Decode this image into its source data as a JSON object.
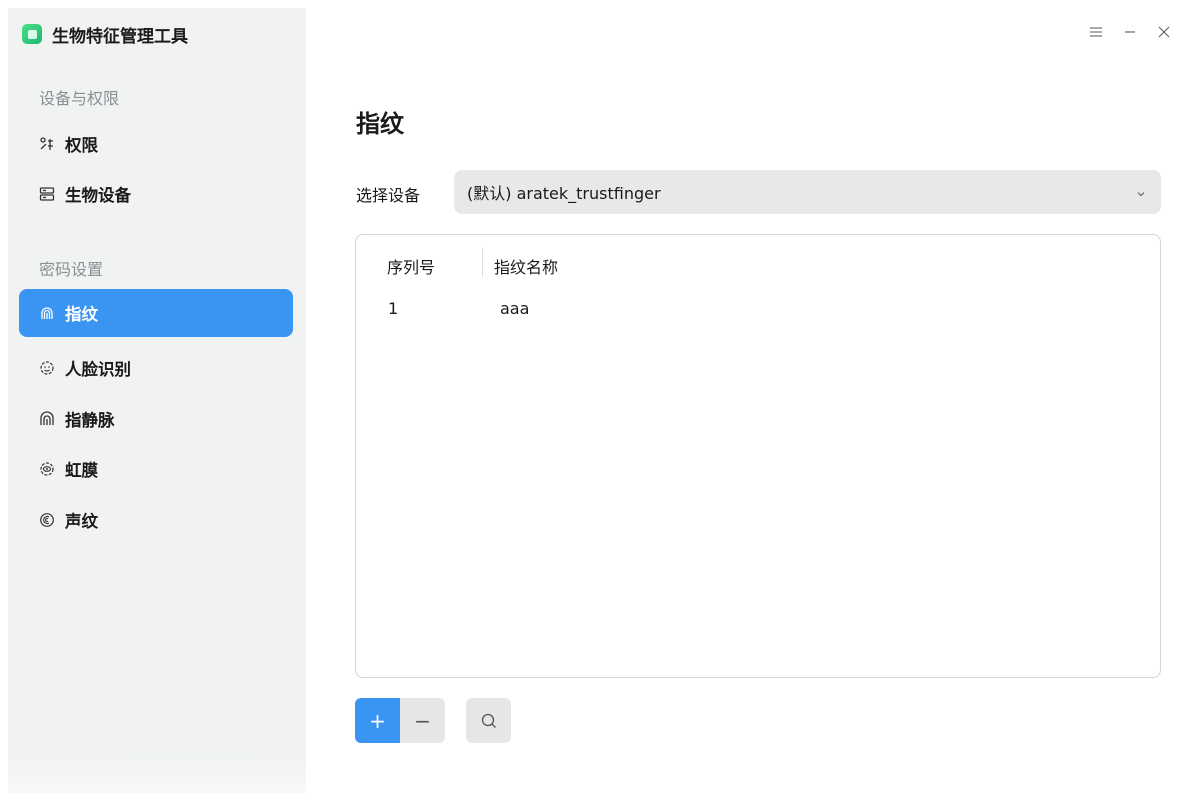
{
  "app": {
    "title": "生物特征管理工具",
    "icon": "app-logo-icon"
  },
  "window_controls": [
    "menu-icon",
    "minimize-icon",
    "close-icon"
  ],
  "sidebar": {
    "groups": [
      {
        "label": "设备与权限",
        "items": [
          {
            "label": "权限",
            "icon": "permission-icon",
            "active": false
          },
          {
            "label": "生物设备",
            "icon": "device-icon",
            "active": false
          }
        ]
      },
      {
        "label": "密码设置",
        "items": [
          {
            "label": "指纹",
            "icon": "fingerprint-icon",
            "active": true
          },
          {
            "label": "人脸识别",
            "icon": "face-icon",
            "active": false
          },
          {
            "label": "指静脉",
            "icon": "finger-vein-icon",
            "active": false
          },
          {
            "label": "虹膜",
            "icon": "iris-icon",
            "active": false
          },
          {
            "label": "声纹",
            "icon": "voiceprint-icon",
            "active": false
          }
        ]
      }
    ]
  },
  "main": {
    "title": "指纹",
    "device": {
      "label": "选择设备",
      "selected": "(默认) aratek_trustfinger"
    },
    "table": {
      "headers": [
        "序列号",
        "指纹名称"
      ],
      "rows": [
        [
          "1",
          "aaa"
        ]
      ]
    },
    "toolbar": {
      "add_label": "+",
      "remove_label": "−"
    }
  },
  "colors": {
    "accent": "#3a94f2",
    "sidebar_bg": "#f0f3f2",
    "select_bg": "#e8e8e8"
  }
}
